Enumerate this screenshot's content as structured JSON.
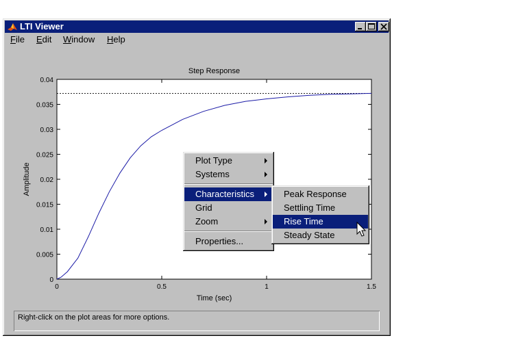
{
  "window": {
    "title": "LTI Viewer",
    "menu": [
      "File",
      "Edit",
      "Window",
      "Help"
    ],
    "menu_mnemonics": [
      "F",
      "E",
      "W",
      "H"
    ]
  },
  "context_menu": {
    "items": [
      "Plot Type",
      "Systems",
      "Characteristics",
      "Grid",
      "Zoom",
      "Properties..."
    ],
    "selected": "Characteristics"
  },
  "submenu": {
    "items": [
      "Peak Response",
      "Settling Time",
      "Rise Time",
      "Steady State"
    ],
    "selected": "Rise Time"
  },
  "status_text": "Right-click on the plot areas for more options.",
  "chart_data": {
    "type": "line",
    "title": "Step Response",
    "xlabel": "Time (sec)",
    "ylabel": "Amplitude",
    "xlim": [
      0,
      1.5
    ],
    "ylim": [
      0,
      0.04
    ],
    "xticks": [
      0,
      0.5,
      1,
      1.5
    ],
    "xtick_labels": [
      "0",
      "0.5",
      "1",
      "1.5"
    ],
    "yticks": [
      0,
      0.005,
      0.01,
      0.015,
      0.02,
      0.025,
      0.03,
      0.035,
      0.04
    ],
    "ytick_labels": [
      "0",
      "0.005",
      "0.01",
      "0.015",
      "0.02",
      "0.025",
      "0.03",
      "0.035",
      "0.04"
    ],
    "steady_state": 0.0372,
    "series": [
      {
        "x": [
          0,
          0.02,
          0.05,
          0.1,
          0.15,
          0.2,
          0.25,
          0.3,
          0.35,
          0.4,
          0.45,
          0.5,
          0.6,
          0.7,
          0.8,
          0.9,
          1.0,
          1.1,
          1.2,
          1.3,
          1.4,
          1.5
        ],
        "values": [
          0,
          0.0004,
          0.0015,
          0.0042,
          0.0085,
          0.0132,
          0.0175,
          0.0212,
          0.0243,
          0.0267,
          0.0285,
          0.0298,
          0.032,
          0.0336,
          0.0348,
          0.0356,
          0.0361,
          0.0365,
          0.0368,
          0.037,
          0.0371,
          0.0372
        ]
      }
    ],
    "line_color": "#1a1aa6"
  }
}
